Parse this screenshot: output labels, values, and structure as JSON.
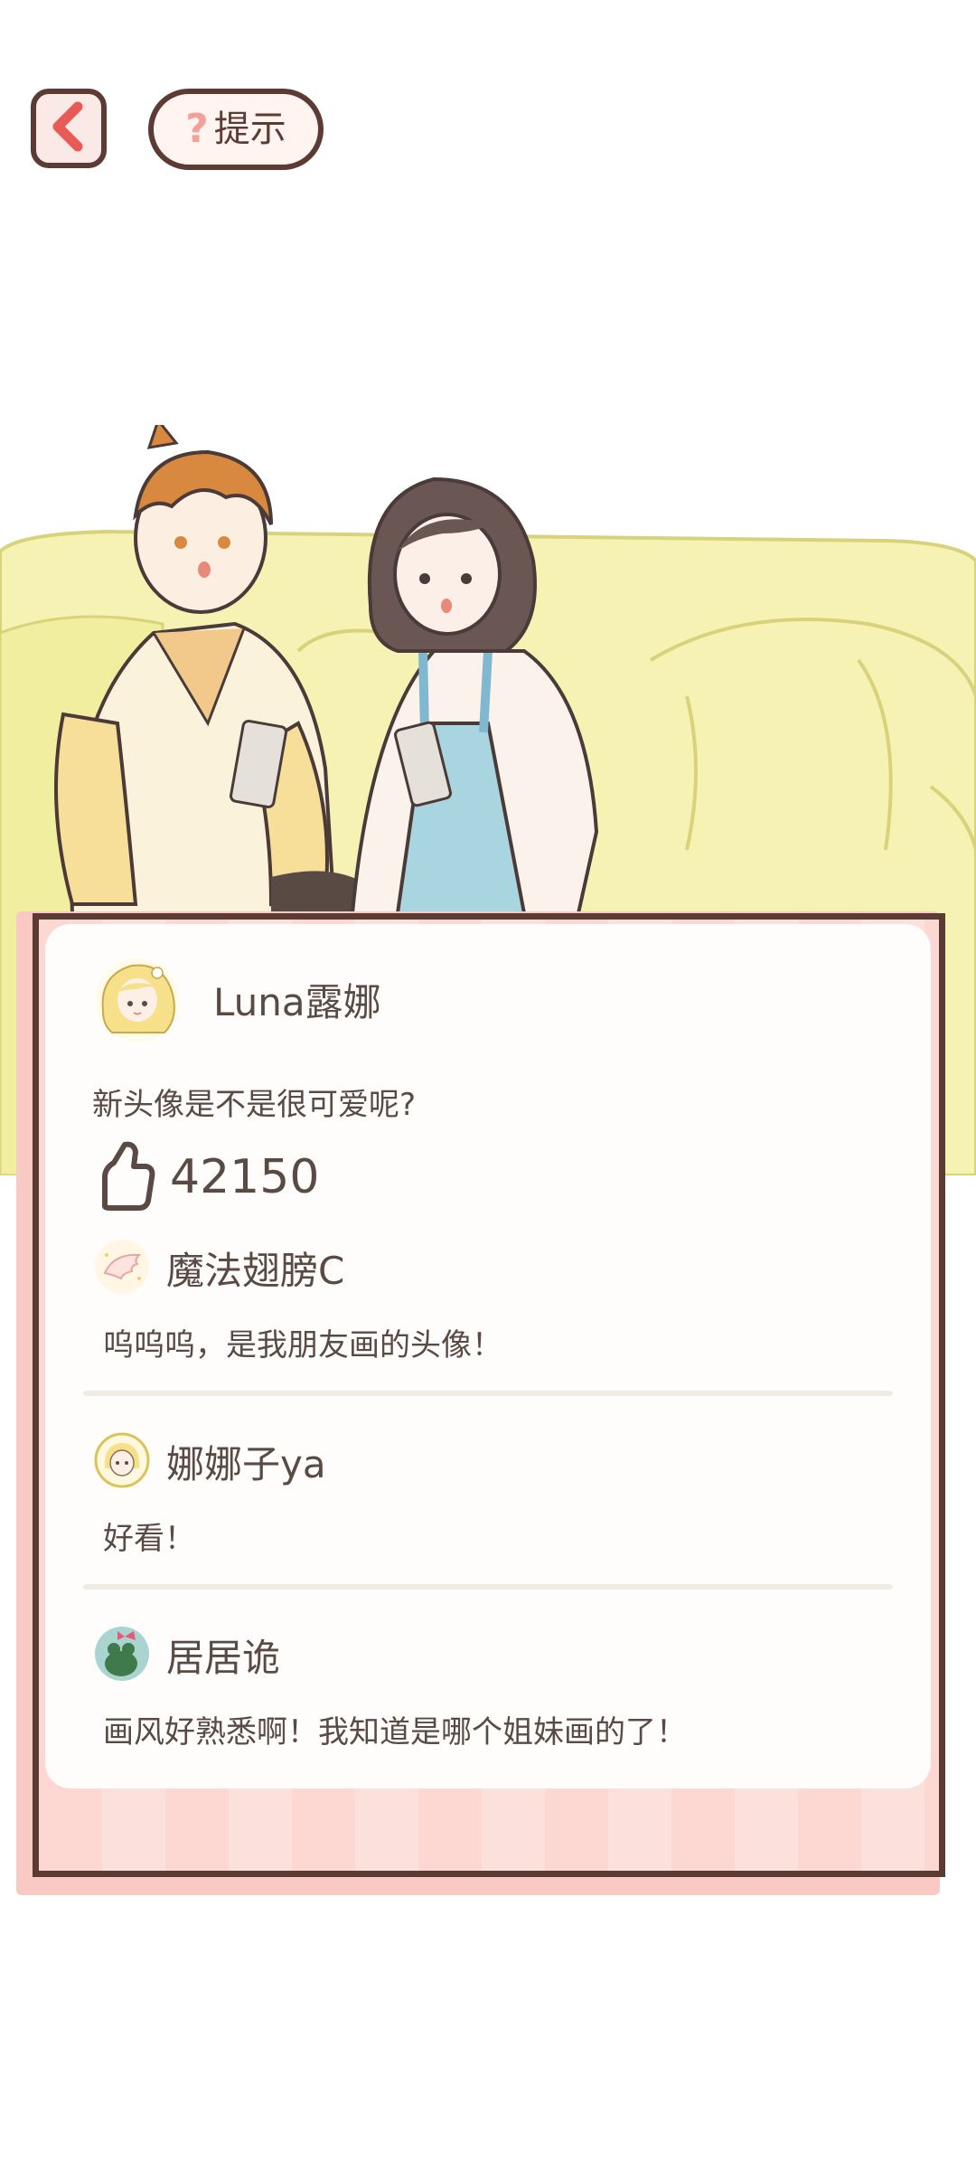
{
  "top_bar": {
    "back_icon": "chevron-left-icon",
    "hint_icon": "question-mark-icon",
    "hint_label": "提示"
  },
  "post": {
    "user_name": "Luna露娜",
    "text": "新头像是不是很可爱呢?",
    "like_icon": "thumbs-up-icon",
    "likes": "42150"
  },
  "comments": [
    {
      "name": "魔法翅膀C",
      "text": "呜呜呜，是我朋友画的头像！",
      "avatar_icon": "wing-icon"
    },
    {
      "name": "娜娜子ya",
      "text": "好看！",
      "avatar_icon": "girl-avatar-icon"
    },
    {
      "name": "居居诡",
      "text": "画风好熟悉啊！我知道是哪个姐妹画的了！",
      "avatar_icon": "frog-avatar-icon"
    }
  ],
  "colors": {
    "outline": "#5b3b34",
    "sofa": "#f4f0b0",
    "frame_pink": "#fdd8d2",
    "text": "#5a4a44"
  }
}
